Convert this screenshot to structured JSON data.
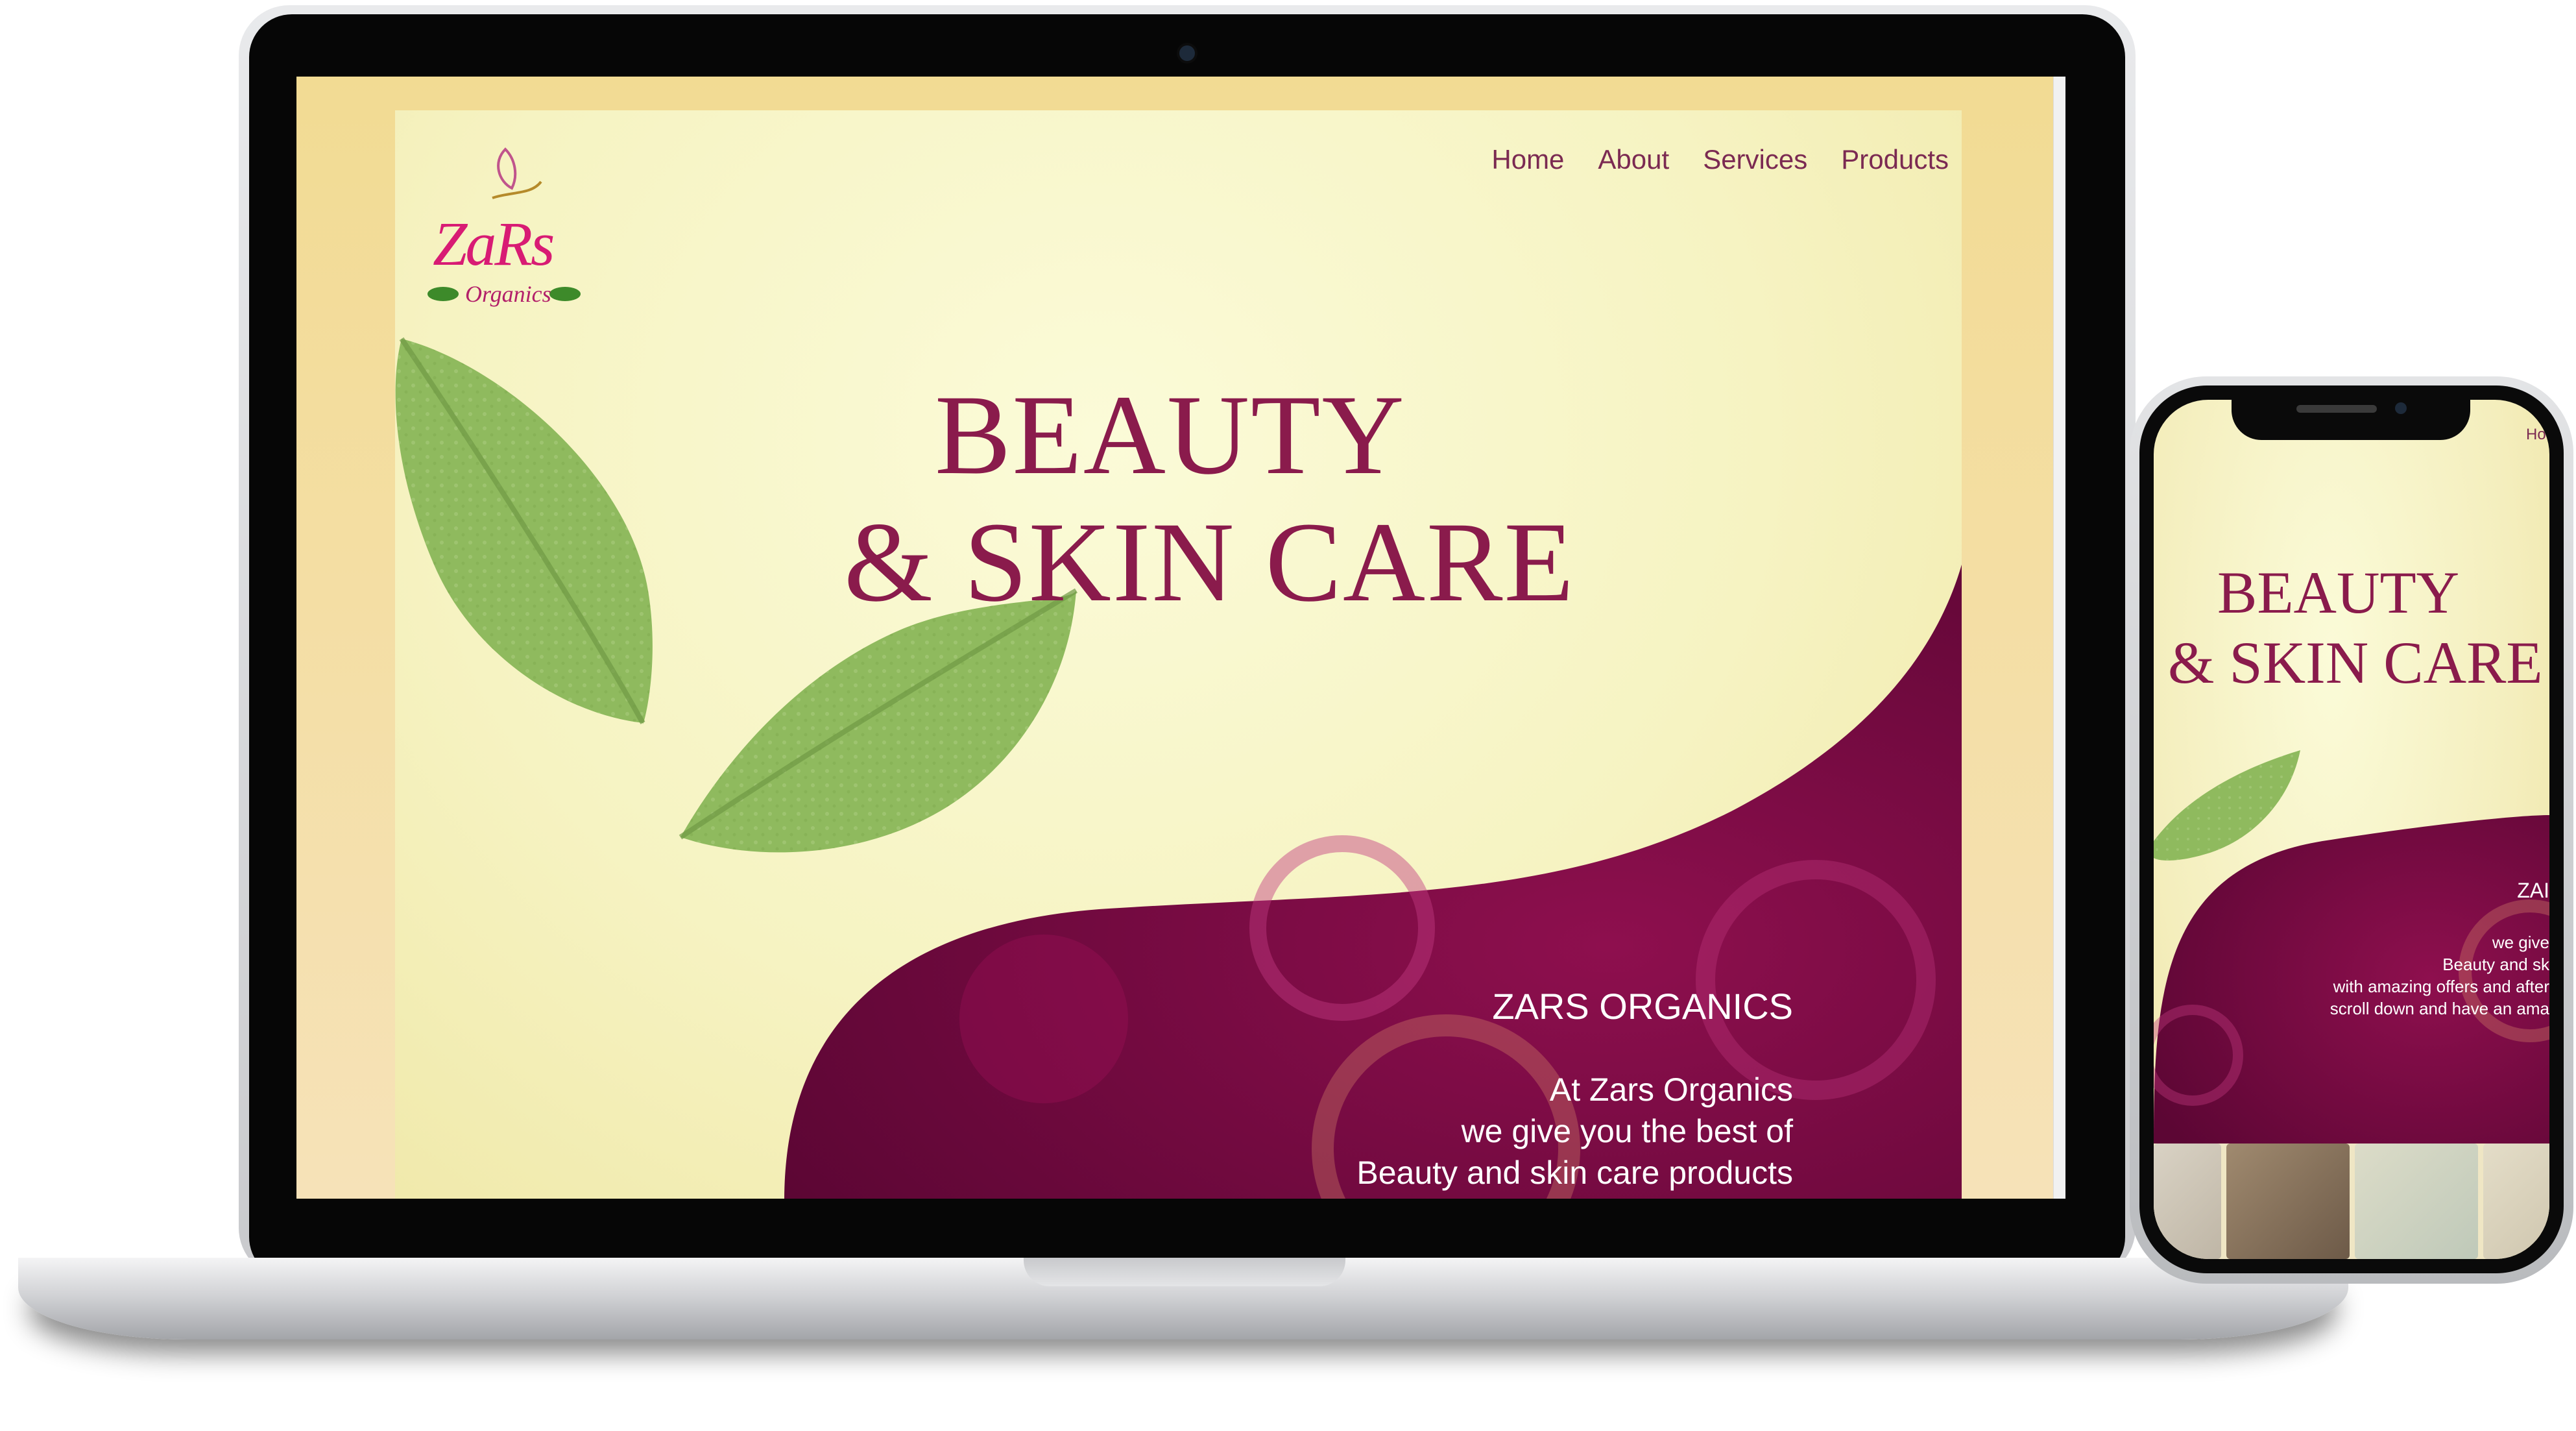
{
  "laptop": {
    "nav": {
      "home": "Home",
      "about": "About",
      "services": "Services",
      "products": "Products"
    },
    "logo": {
      "brand": "ZaRs",
      "sub": "Organics"
    },
    "hero": {
      "line1": "BEAUTY",
      "line2": "& SKIN CARE"
    },
    "section": {
      "title": "ZARS ORGANICS",
      "lines": [
        "At Zars Organics",
        "we give you the best of",
        "Beauty and skin care products"
      ]
    }
  },
  "phone": {
    "nav": {
      "home": "Hon"
    },
    "hero": {
      "line1": "BEAUTY",
      "line2": "& SKIN CARE"
    },
    "section": {
      "title": "ZAI",
      "lines": [
        "we give",
        "Beauty and sk",
        "with amazing offers and after",
        "scroll down and have an ama"
      ]
    }
  },
  "colors": {
    "accent": "#8a1b4c",
    "wave_dark": "#6e0a3c",
    "wave_light": "#b8145c",
    "leaf": "#8fba5e",
    "bg": "#f6f3c2"
  }
}
